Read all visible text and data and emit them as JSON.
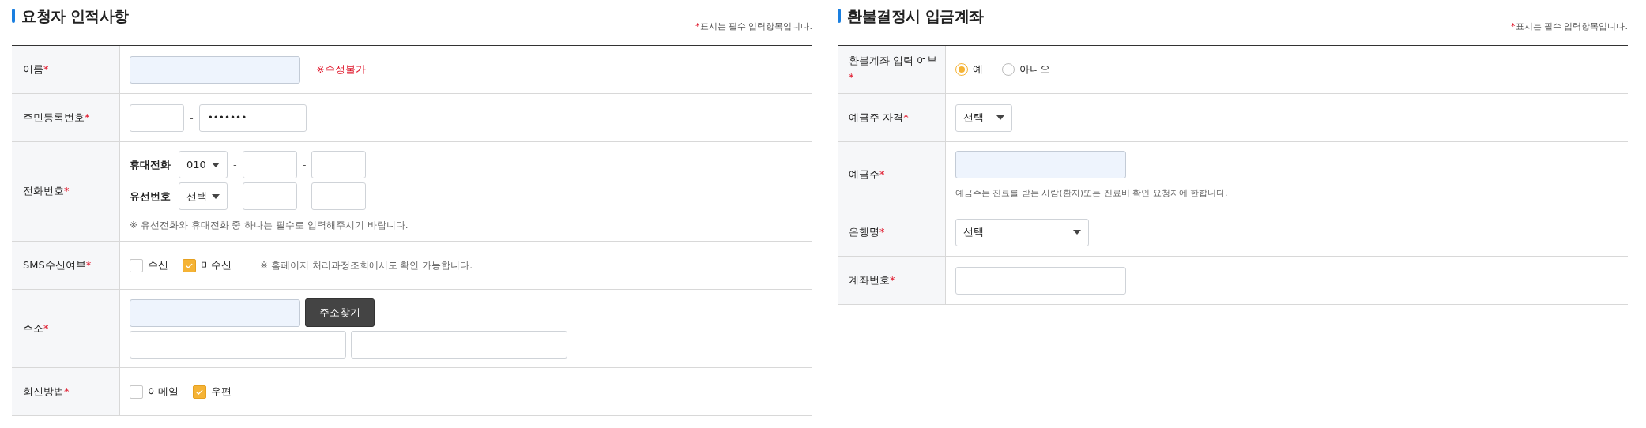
{
  "panels": [
    {
      "title": "요청자 인적사항",
      "required_note": {
        "mark": "*",
        "text": "표시는 필수 입력항목입니다."
      },
      "rows": [
        {
          "label": "이름",
          "mark": "*",
          "lines": [
            {
              "items": [
                {
                  "kind": "field",
                  "readonly": true
                },
                {
                  "kind": "warning",
                  "text": "※수정불가"
                }
              ]
            }
          ]
        },
        {
          "label": "주민등록번호",
          "mark": "*",
          "lines": [
            {
              "items": [
                {
                  "kind": "tinyfield",
                  "readonly": false
                },
                {
                  "kind": "sep",
                  "text": "-"
                },
                {
                  "kind": "smallfield",
                  "readonly": false,
                  "value": "•••••••"
                }
              ]
            }
          ]
        },
        {
          "label": "전화번호",
          "mark": "*",
          "lines": [
            {
              "items": [
                {
                  "kind": "sublabel",
                  "text": "휴대전화"
                },
                {
                  "kind": "narrowselect",
                  "text": "010"
                },
                {
                  "kind": "sep",
                  "text": "-"
                },
                {
                  "kind": "tinyfield",
                  "readonly": false
                },
                {
                  "kind": "sep",
                  "text": "-"
                },
                {
                  "kind": "tinyfield",
                  "readonly": false
                }
              ]
            },
            {
              "items": [
                {
                  "kind": "sublabel",
                  "text": "유선번호"
                },
                {
                  "kind": "narrowselect",
                  "text": "선택"
                },
                {
                  "kind": "sep",
                  "text": "-"
                },
                {
                  "kind": "tinyfield",
                  "readonly": false
                },
                {
                  "kind": "sep",
                  "text": "-"
                },
                {
                  "kind": "tinyfield",
                  "readonly": false
                }
              ]
            },
            {
              "items": [
                {
                  "kind": "note",
                  "text": "※ 유선전화와 휴대전화 중 하나는 필수로 입력해주시기 바랍니다."
                }
              ]
            }
          ]
        },
        {
          "label": "SMS수신여부",
          "mark": "*",
          "lines": [
            {
              "items": [
                {
                  "kind": "check",
                  "text": "수신",
                  "checked": false
                },
                {
                  "kind": "check",
                  "text": "미수신",
                  "checked": true
                },
                {
                  "kind": "note",
                  "text": "※ 홈페이지 처리과정조회에서도 확인 가능합니다."
                }
              ]
            }
          ]
        },
        {
          "label": "주소",
          "mark": "*",
          "lines": [
            {
              "items": [
                {
                  "kind": "field",
                  "readonly": true
                },
                {
                  "kind": "button",
                  "text": "주소찾기"
                }
              ]
            },
            {
              "items": [
                {
                  "kind": "widefield",
                  "readonly": false
                },
                {
                  "kind": "widefield",
                  "readonly": false
                }
              ]
            }
          ]
        },
        {
          "label": "회신방법",
          "mark": "*",
          "lines": [
            {
              "items": [
                {
                  "kind": "check",
                  "text": "이메일",
                  "checked": false
                },
                {
                  "kind": "check",
                  "text": "우편",
                  "checked": true
                }
              ]
            }
          ]
        }
      ]
    },
    {
      "title": "환불결정시 입금계좌",
      "required_note": {
        "mark": "*",
        "text": "표시는 필수 입력항목입니다."
      },
      "rows": [
        {
          "label": "환불계좌 입력 여부",
          "mark": "*",
          "lines": [
            {
              "items": [
                {
                  "kind": "radio",
                  "text": "예",
                  "selected": true
                },
                {
                  "kind": "radio",
                  "text": "아니오",
                  "selected": false
                }
              ]
            }
          ]
        },
        {
          "label": "예금주 자격",
          "mark": "*",
          "lines": [
            {
              "items": [
                {
                  "kind": "select",
                  "text": "선택"
                }
              ]
            }
          ]
        },
        {
          "label": "예금주",
          "mark": "*",
          "lines": [
            {
              "items": [
                {
                  "kind": "field",
                  "readonly": true
                }
              ]
            },
            {
              "items": [
                {
                  "kind": "smallnote",
                  "text": "예금주는 진료를 받는 사람(환자)또는 진료비 확인 요청자에 한합니다."
                }
              ]
            }
          ]
        },
        {
          "label": "은행명",
          "mark": "*",
          "lines": [
            {
              "items": [
                {
                  "kind": "wideselect",
                  "text": "선택"
                }
              ]
            }
          ]
        },
        {
          "label": "계좌번호",
          "mark": "*",
          "lines": [
            {
              "items": [
                {
                  "kind": "field",
                  "readonly": false
                }
              ]
            }
          ]
        }
      ]
    }
  ]
}
